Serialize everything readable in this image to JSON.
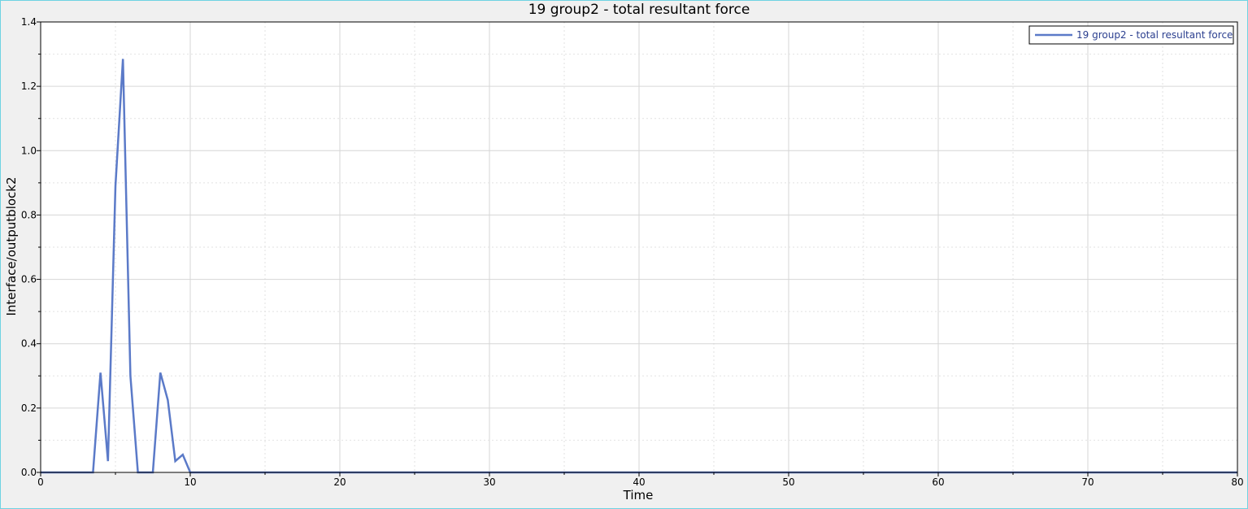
{
  "chart_data": {
    "type": "line",
    "title": "19 group2 - total resultant force",
    "xlabel": "Time",
    "ylabel": "Interface/outputblock2",
    "xlim": [
      0,
      80
    ],
    "ylim": [
      0,
      1.4
    ],
    "x_ticks": [
      "0",
      "10",
      "20",
      "30",
      "40",
      "50",
      "60",
      "70",
      "80"
    ],
    "y_ticks": [
      "0.0",
      "0.2",
      "0.4",
      "0.6",
      "0.8",
      "1.0",
      "1.2",
      "1.4"
    ],
    "grid": true,
    "legend": "top-right",
    "series": [
      {
        "name": "19 group2 - total resultant force",
        "color": "#5b7ac8",
        "x": [
          0,
          3.5,
          4.0,
          4.5,
          5.0,
          5.5,
          6.0,
          6.5,
          7.0,
          7.5,
          8.0,
          8.5,
          9.0,
          9.5,
          10.0,
          80
        ],
        "y": [
          0,
          0,
          0.31,
          0.035,
          0.89,
          1.285,
          0.3,
          0,
          0,
          0,
          0.31,
          0.225,
          0.035,
          0.055,
          0,
          0
        ]
      }
    ]
  }
}
